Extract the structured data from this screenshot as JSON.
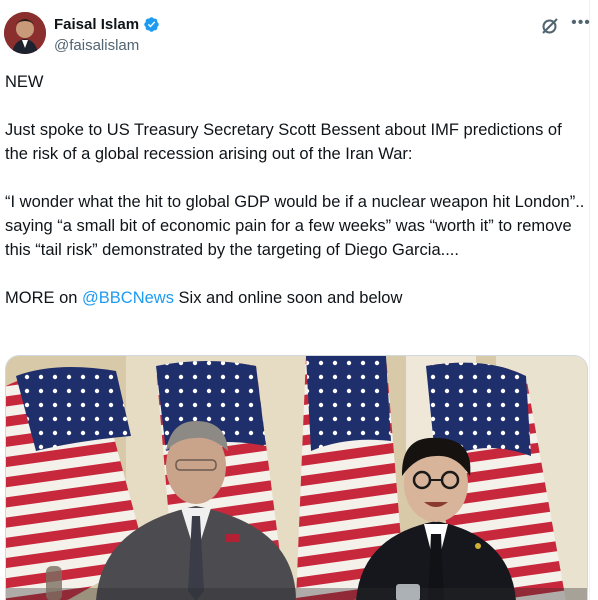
{
  "author": {
    "display_name": "Faisal Islam",
    "handle": "@faisalislam",
    "verified": true
  },
  "icons": {
    "verified": "verified-badge-icon",
    "grok": "grok-icon",
    "more": "more-options-icon"
  },
  "tweet": {
    "line1": "NEW",
    "line2": "Just spoke to US Treasury Secretary Scott Bessent about IMF predictions of the risk of a global recession arising out of the Iran War:",
    "line3": "“I wonder what the hit to global GDP would be if a nuclear weapon hit London”.. saying “a small bit of economic pain for a few weeks” was “worth it” to remove this “tail risk” demonstrated by the targeting of Diego Garcia....",
    "line4_prefix": "MORE on ",
    "line4_mention": "@BBCNews",
    "line4_suffix": " Six and online soon and below"
  },
  "colors": {
    "link": "#1d9bf0",
    "text": "#0f1419",
    "secondary": "#536471",
    "verified": "#1d9bf0"
  }
}
